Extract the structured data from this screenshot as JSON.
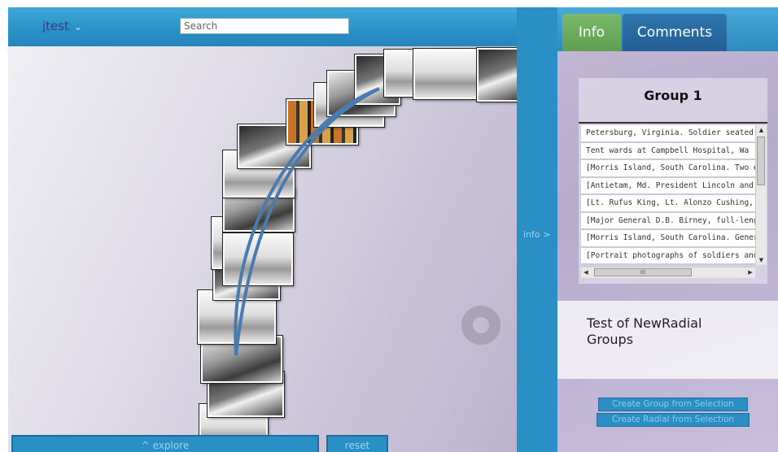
{
  "header": {
    "user_label": "jtest",
    "search_placeholder": "Search"
  },
  "left_panel": {
    "explore_label": "^ explore",
    "reset_label": "reset"
  },
  "divider": {
    "info_toggle_label": "info >"
  },
  "right_panel": {
    "tabs": [
      {
        "label": "Info"
      },
      {
        "label": "Comments"
      }
    ],
    "group_title": "Group 1",
    "items": [
      {
        "label": "Petersburg, Virginia. Soldier seated b"
      },
      {
        "label": "Tent wards at Campbell Hospital, Wa"
      },
      {
        "label": "[Morris Island, South Carolina. Two e"
      },
      {
        "label": "[Antietam, Md. President Lincoln and"
      },
      {
        "label": "[Lt. Rufus King, Lt. Alonzo Cushing, L"
      },
      {
        "label": "[Major General D.B. Birney, full-lengt"
      },
      {
        "label": "[Morris Island, South Carolina. Gener"
      },
      {
        "label": "[Portrait photographs of soldiers and"
      }
    ],
    "hscroll_label": "III",
    "description": "Test of NewRadial Groups",
    "create_group_label": "Create Group from Selection",
    "create_radial_label": "Create Radial from Selection"
  },
  "colors": {
    "header_blue": "#2a8fc4",
    "tab_active_green": "#6aab5c",
    "tab_inactive_blue": "#2e76b0",
    "arc_stroke": "#4a7bb0"
  }
}
